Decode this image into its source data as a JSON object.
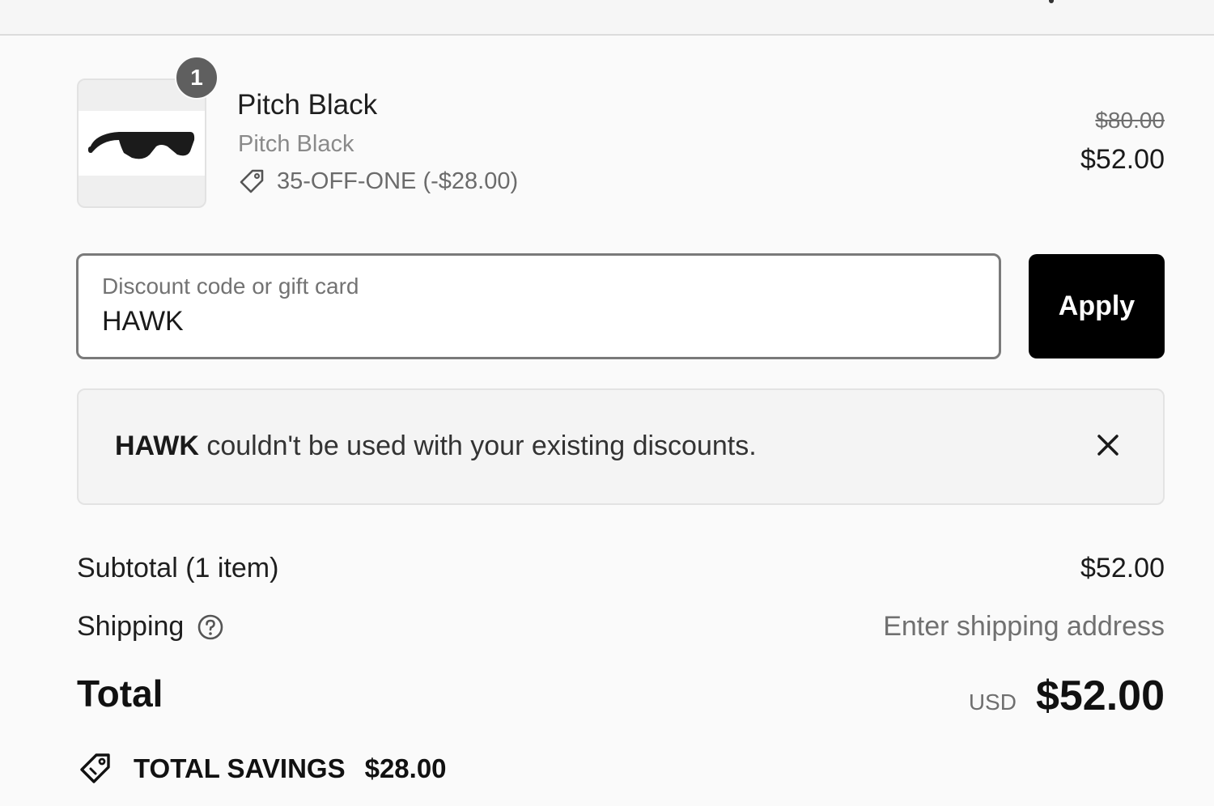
{
  "product": {
    "title": "Pitch Black",
    "variant": "Pitch Black",
    "quantity": "1",
    "discount": "35-OFF-ONE (-$28.00)",
    "original_price": "$80.00",
    "price": "$52.00",
    "image_icon": "sunglasses-image"
  },
  "discount_field": {
    "label": "Discount code or gift card",
    "value": "HAWK",
    "apply_label": "Apply"
  },
  "notice": {
    "code": "HAWK",
    "message": " couldn't be used with your existing discounts."
  },
  "summary": {
    "subtotal_label": "Subtotal (1 item)",
    "subtotal_value": "$52.00",
    "shipping_label": "Shipping",
    "shipping_value": "Enter shipping address",
    "total_label": "Total",
    "currency": "USD",
    "total_value": "$52.00",
    "savings_label": "TOTAL SAVINGS",
    "savings_value": "$28.00"
  },
  "colors": {
    "apply_button": "#000000",
    "badge": "#5f5f5f",
    "background": "#fafafa"
  }
}
